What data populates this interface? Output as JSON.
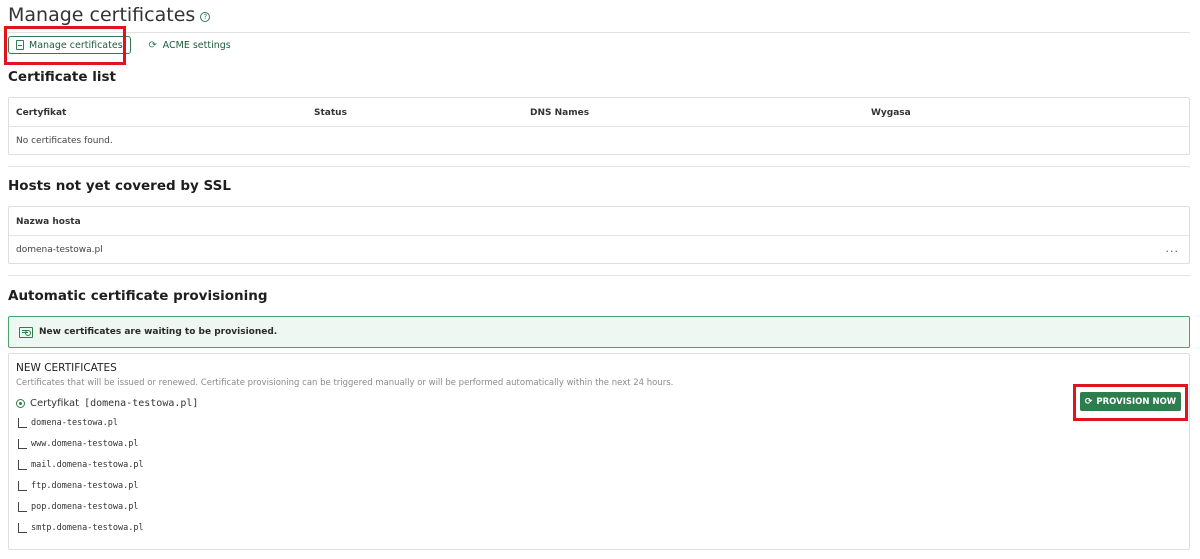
{
  "header": {
    "title": "Manage certificates",
    "help_glyph": "?"
  },
  "tabs": [
    {
      "label": "Manage certificates",
      "icon": "document-icon",
      "active": true
    },
    {
      "label": "ACME settings",
      "icon": "refresh-icon",
      "active": false
    }
  ],
  "certificate_list": {
    "title": "Certificate list",
    "columns": [
      "Certyfikat",
      "Status",
      "DNS Names",
      "Wygasa"
    ],
    "empty_text": "No certificates found."
  },
  "hosts": {
    "title": "Hosts not yet covered by SSL",
    "column": "Nazwa hosta",
    "rows": [
      "domena-testowa.pl"
    ],
    "row_menu_glyph": "···"
  },
  "provisioning": {
    "title": "Automatic certificate provisioning",
    "alert": "New certificates are waiting to be provisioned.",
    "heading": "NEW CERTIFICATES",
    "description": "Certificates that will be issued or renewed. Certificate provisioning can be triggered manually or will be performed automatically within the next 24 hours.",
    "certificate_label": "Certyfikat",
    "certificate_name": "[domena-testowa.pl]",
    "domains": [
      "domena-testowa.pl",
      "www.domena-testowa.pl",
      "mail.domena-testowa.pl",
      "ftp.domena-testowa.pl",
      "pop.domena-testowa.pl",
      "smtp.domena-testowa.pl"
    ],
    "button_label": "PROVISION NOW"
  },
  "colors": {
    "accent": "#2e7d4f",
    "alert_bg": "#eef7f1",
    "highlight": "#e0141e"
  }
}
